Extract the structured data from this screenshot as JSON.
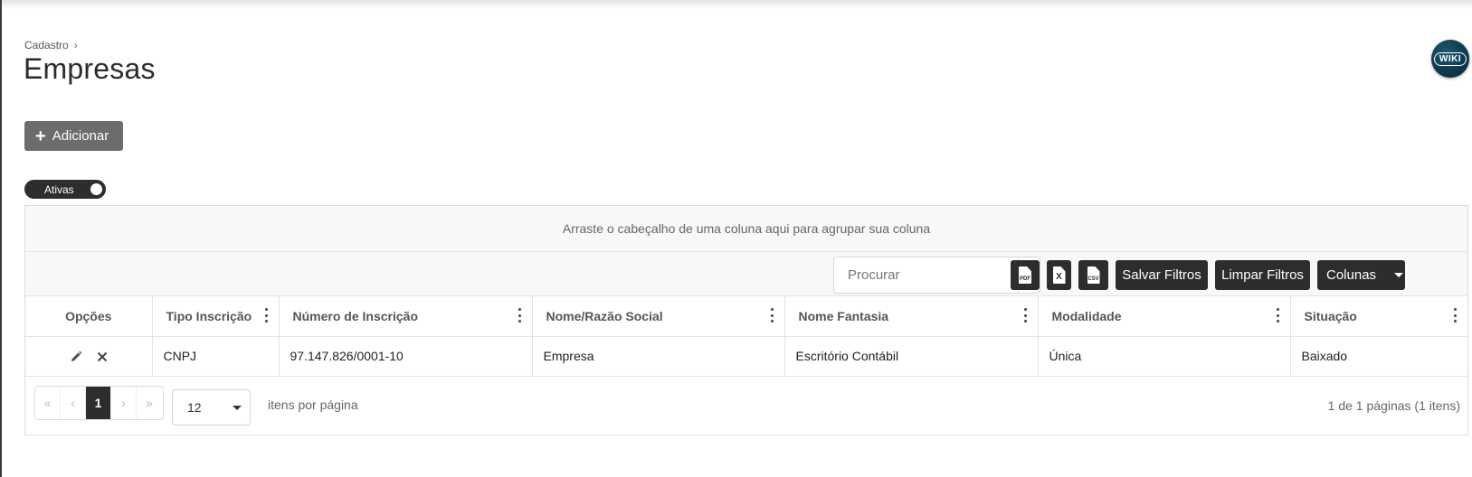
{
  "breadcrumb": {
    "parent": "Cadastro"
  },
  "page": {
    "title": "Empresas"
  },
  "wiki": {
    "label": "WIKI"
  },
  "actions": {
    "add_label": "Adicionar"
  },
  "filter_toggle": {
    "label": "Ativas",
    "on": true
  },
  "grid": {
    "group_hint": "Arraste o cabeçalho de uma coluna aqui para agrupar sua coluna",
    "search_placeholder": "Procurar",
    "export_pdf": "PDF",
    "export_excel": "X",
    "export_csv": "CSV",
    "save_filters": "Salvar Filtros",
    "clear_filters": "Limpar Filtros",
    "columns_button": "Colunas",
    "columns": [
      "Opções",
      "Tipo Inscrição",
      "Número de Inscrição",
      "Nome/Razão Social",
      "Nome Fantasia",
      "Modalidade",
      "Situação"
    ],
    "rows": [
      {
        "tipo": "CNPJ",
        "numero": "97.147.826/0001-10",
        "nome": "Empresa",
        "fantasia": "Escritório Contábil",
        "modalidade": "Única",
        "situacao": "Baixado"
      }
    ]
  },
  "pager": {
    "first": "«",
    "prev": "‹",
    "current_page": "1",
    "next": "›",
    "last": "»",
    "page_size": "12",
    "per_page_label": "itens por página",
    "info": "1 de 1 páginas (1 itens)"
  },
  "icons": {
    "add": "plus-icon",
    "search": "search-icon",
    "edit": "pencil-icon",
    "delete": "close-icon",
    "menu": "kebab-icon"
  }
}
